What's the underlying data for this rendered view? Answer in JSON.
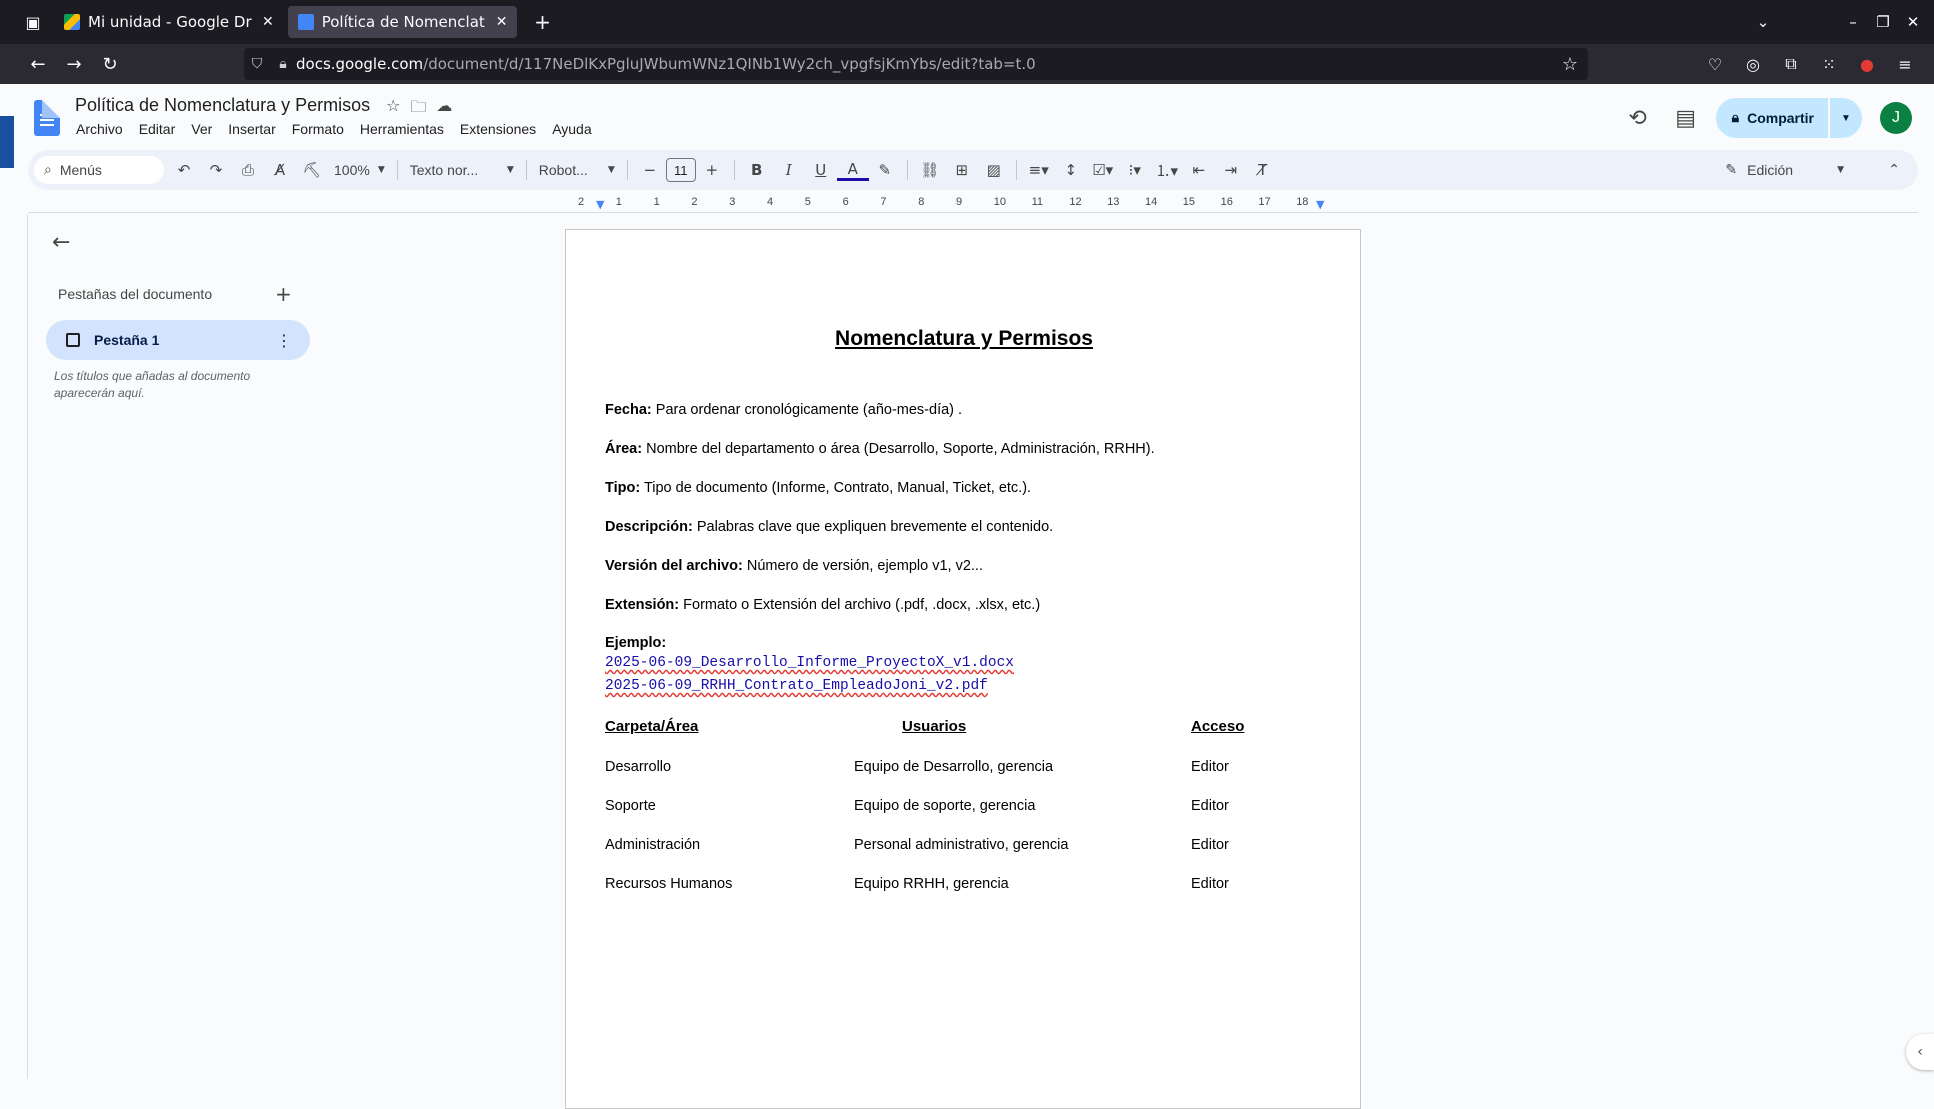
{
  "browser": {
    "tabs": [
      {
        "title": "Mi unidad - Google Drive"
      },
      {
        "title": "Política de Nomenclatura"
      }
    ],
    "url_host": "docs.google.com",
    "url_path": "/document/d/117NeDlKxPgluJWbumWNz1QINb1Wy2ch_vpgfsjKmYbs/edit?tab=t.0"
  },
  "docs": {
    "title": "Política de Nomenclatura y Permisos",
    "menu": [
      "Archivo",
      "Editar",
      "Ver",
      "Insertar",
      "Formato",
      "Herramientas",
      "Extensiones",
      "Ayuda"
    ],
    "share_label": "Compartir",
    "avatar_letter": "J"
  },
  "toolbar": {
    "search_label": "Menús",
    "zoom": "100%",
    "style": "Texto nor...",
    "font": "Robot...",
    "font_size": "11",
    "mode": "Edición"
  },
  "ruler": {
    "numbers": [
      "2",
      "1",
      "1",
      "2",
      "3",
      "4",
      "5",
      "6",
      "7",
      "8",
      "9",
      "10",
      "11",
      "12",
      "13",
      "14",
      "15",
      "16",
      "17",
      "18"
    ]
  },
  "sidebar": {
    "title": "Pestañas del documento",
    "tab_label": "Pestaña 1",
    "hint": "Los títulos que añadas al documento aparecerán aquí."
  },
  "document": {
    "heading": "Nomenclatura y Permisos",
    "fields": [
      {
        "label": "Fecha:",
        "text": " Para ordenar cronológicamente (año-mes-día) ."
      },
      {
        "label": "Área:",
        "text": " Nombre del departamento o área (Desarrollo, Soporte, Administración, RRHH)."
      },
      {
        "label": "Tipo:",
        "text": " Tipo de documento (Informe, Contrato, Manual, Ticket, etc.)."
      },
      {
        "label": "Descripción:",
        "text": " Palabras clave que expliquen brevemente el contenido."
      },
      {
        "label": "Versión del archivo:",
        "text": " Número de versión, ejemplo v1, v2..."
      },
      {
        "label": "Extensión:",
        "text": " Formato o Extensión del archivo (.pdf, .docx, .xlsx, etc.)"
      }
    ],
    "example_label": "Ejemplo:",
    "examples": [
      "2025-06-09_Desarrollo_Informe_ProyectoX_v1.docx",
      "2025-06-09_RRHH_Contrato_EmpleadoJoni_v2.pdf"
    ],
    "table": {
      "headers": [
        "Carpeta/Área",
        "Usuarios",
        "Acceso"
      ],
      "rows": [
        [
          "Desarrollo",
          "Equipo de Desarrollo, gerencia",
          "Editor"
        ],
        [
          "Soporte",
          "Equipo de soporte, gerencia",
          "Editor"
        ],
        [
          "Administración",
          "Personal administrativo, gerencia",
          "Editor"
        ],
        [
          "Recursos Humanos",
          "Equipo RRHH, gerencia",
          "Editor"
        ]
      ]
    }
  }
}
